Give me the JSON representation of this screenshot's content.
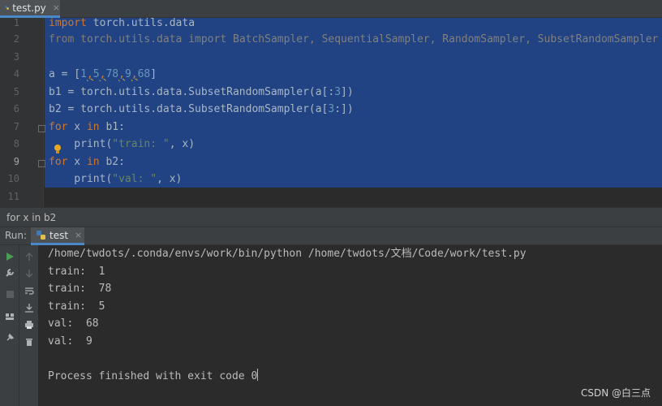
{
  "editor_tab": {
    "label": "test.py",
    "close": "×"
  },
  "editor": {
    "lines": [
      {
        "n": "1"
      },
      {
        "n": "2"
      },
      {
        "n": "3"
      },
      {
        "n": "4"
      },
      {
        "n": "5"
      },
      {
        "n": "6"
      },
      {
        "n": "7"
      },
      {
        "n": "8"
      },
      {
        "n": "9"
      },
      {
        "n": "10"
      },
      {
        "n": "11"
      }
    ],
    "code": {
      "l1_kw": "import",
      "l1_rest": " torch.utils.data",
      "l2_kw": "from",
      "l2_mod": " torch.utils.data ",
      "l2_kw2": "import",
      "l2_rest": " BatchSampler, SequentialSampler, RandomSampler, SubsetRandomSampler",
      "l4_a": "a = [",
      "l4_n1": "1",
      "l4_n2": "5",
      "l4_n3": "78",
      "l4_n4": "9",
      "l4_n5": "68",
      "l4_c": ",",
      "l4_close": "]",
      "l5_a": "b1 = torch.utils.data.SubsetRandomSampler(a[:",
      "l5_n": "3",
      "l5_b": "])",
      "l6_a": "b2 = torch.utils.data.SubsetRandomSampler(a[",
      "l6_n": "3",
      "l6_b": ":])",
      "l7_kw": "for",
      "l7_mid": " x ",
      "l7_kw2": "in",
      "l7_rest": " b1:",
      "l8_a": "    print(",
      "l8_s": "\"train: \"",
      "l8_b": ", x)",
      "l9_kw": "for",
      "l9_mid": " x ",
      "l9_kw2": "in",
      "l9_rest": " b2:",
      "l10_a": "    print(",
      "l10_s": "\"val: \"",
      "l10_b": ", x)"
    }
  },
  "breadcrumb": "for x in b2",
  "run": {
    "label": "Run:",
    "tab_label": "test",
    "close": "×"
  },
  "console": {
    "command": "/home/twdots/.conda/envs/work/bin/python /home/twdots/文档/Code/work/test.py",
    "outputs": [
      "train:  1",
      "train:  78",
      "train:  5",
      "val:  68",
      "val:  9"
    ],
    "exit": "Process finished with exit code 0"
  },
  "watermark": "CSDN @白三点",
  "colors": {
    "selection": "#214283",
    "keyword": "#cc7832",
    "number": "#6897bb",
    "string": "#6a8759",
    "accent": "#4a88c7"
  }
}
